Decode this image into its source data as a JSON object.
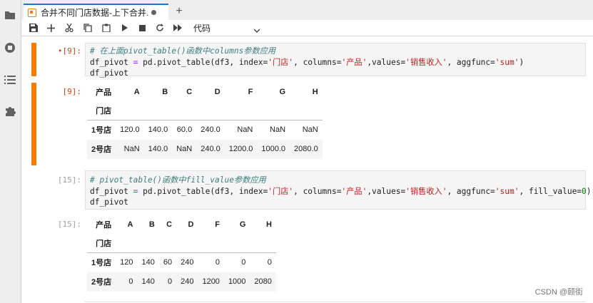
{
  "tab": {
    "title": "合并不同门店数据-上下合并."
  },
  "toolbar": {
    "cell_type": "代码"
  },
  "cells": [
    {
      "prompt": "[9]:",
      "code": {
        "comment": "# 在上面pivot_table()函数中columns参数应用",
        "line2_a": "df_pivot ",
        "line2_op": "=",
        "line2_b": " pd.pivot_table(df3, index=",
        "s1": "'门店'",
        "line2_c": ", columns=",
        "s2": "'产品'",
        "line2_d": ",values=",
        "s3": "'销售收入'",
        "line2_e": ", aggfunc=",
        "s4": "'sum'",
        "line2_f": ")",
        "line3": "df_pivot"
      }
    },
    {
      "prompt": "[9]:",
      "table": {
        "columns_label": "产品",
        "index_label": "门店",
        "columns": [
          "A",
          "B",
          "C",
          "D",
          "F",
          "G",
          "H"
        ],
        "rows": [
          {
            "index": "1号店",
            "values": [
              "120.0",
              "140.0",
              "60.0",
              "240.0",
              "NaN",
              "NaN",
              "NaN"
            ]
          },
          {
            "index": "2号店",
            "values": [
              "NaN",
              "140.0",
              "NaN",
              "240.0",
              "1200.0",
              "1000.0",
              "2080.0"
            ]
          }
        ]
      }
    },
    {
      "prompt": "[15]:",
      "code": {
        "comment": "# pivot_table()函数中fill_value参数应用",
        "line2_a": "df_pivot ",
        "line2_op": "=",
        "line2_b": " pd.pivot_table(df3, index=",
        "s1": "'门店'",
        "line2_c": ", columns=",
        "s2": "'产品'",
        "line2_d": ",values=",
        "s3": "'销售收入'",
        "line2_e": ", aggfunc=",
        "s4": "'sum'",
        "line2_f": ", fill_value=",
        "num": "0",
        "line2_g": ")",
        "line3": "df_pivot"
      }
    },
    {
      "prompt": "[15]:",
      "table": {
        "columns_label": "产品",
        "index_label": "门店",
        "columns": [
          "A",
          "B",
          "C",
          "D",
          "F",
          "G",
          "H"
        ],
        "rows": [
          {
            "index": "1号店",
            "values": [
              "120",
              "140",
              "60",
              "240",
              "0",
              "0",
              "0"
            ]
          },
          {
            "index": "2号店",
            "values": [
              "0",
              "140",
              "0",
              "240",
              "1200",
              "1000",
              "2080"
            ]
          }
        ]
      }
    }
  ],
  "watermark": "CSDN @颐街"
}
